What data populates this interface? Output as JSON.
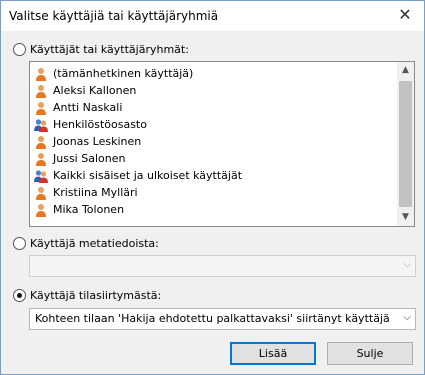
{
  "window": {
    "title": "Valitse käyttäjiä tai käyttäjäryhmiä",
    "close_glyph": "✕"
  },
  "options": {
    "users": {
      "label": "Käyttäjät tai käyttäjäryhmät:",
      "selected": false
    },
    "metadata": {
      "label": "Käyttäjä metatiedoista:",
      "selected": false,
      "value": ""
    },
    "transition": {
      "label": "Käyttäjä tilasiirtymästä:",
      "selected": true,
      "value": "Kohteen tilaan 'Hakija ehdotettu palkattavaksi' siirtänyt käyttäjä"
    }
  },
  "list": {
    "items": [
      {
        "label": "(tämänhetkinen käyttäjä)",
        "icon": "user-icon"
      },
      {
        "label": "Aleksi Kallonen",
        "icon": "user-icon"
      },
      {
        "label": "Antti Naskali",
        "icon": "user-icon"
      },
      {
        "label": "Henkilöstöosasto",
        "icon": "group-icon"
      },
      {
        "label": "Joonas Leskinen",
        "icon": "user-icon"
      },
      {
        "label": "Jussi Salonen",
        "icon": "user-icon"
      },
      {
        "label": "Kaikki sisäiset ja ulkoiset käyttäjät",
        "icon": "group-icon"
      },
      {
        "label": "Kristiina Mylläri",
        "icon": "user-icon"
      },
      {
        "label": "Mika Tolonen",
        "icon": "user-icon"
      }
    ],
    "scroll_up_glyph": "▲",
    "scroll_down_glyph": "▼"
  },
  "combo_arrow_glyph": "⌵",
  "buttons": {
    "add": "Lisää",
    "close": "Sulje"
  }
}
